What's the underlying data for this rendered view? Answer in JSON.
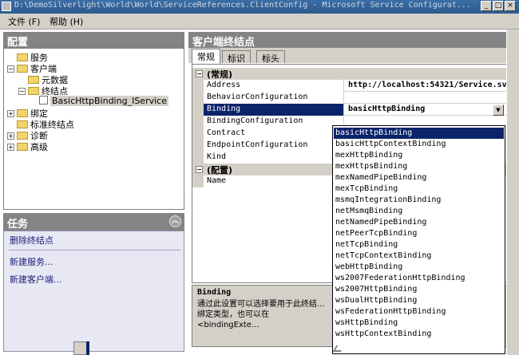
{
  "window": {
    "title": "D:\\DemoSilverlight\\World\\World\\ServiceReferences.ClientConfig - Microsoft Service Configurat..."
  },
  "menu": {
    "items": [
      "文件 (F)",
      "帮助 (H)"
    ]
  },
  "config_panel": {
    "title": "配置",
    "tree": [
      {
        "label": "服务",
        "toggle": "",
        "kind": "folder"
      },
      {
        "label": "客户端",
        "toggle": "−",
        "kind": "folder"
      },
      {
        "label": "元数据",
        "toggle": "",
        "kind": "folder"
      },
      {
        "label": "终结点",
        "toggle": "−",
        "kind": "folder"
      },
      {
        "label": "BasicHttpBinding_IService",
        "toggle": "",
        "kind": "doc"
      },
      {
        "label": "绑定",
        "toggle": "+",
        "kind": "folder"
      },
      {
        "label": "标准终结点",
        "toggle": "",
        "kind": "folder"
      },
      {
        "label": "诊断",
        "toggle": "+",
        "kind": "folder"
      },
      {
        "label": "高级",
        "toggle": "+",
        "kind": "folder"
      }
    ]
  },
  "tasks_panel": {
    "title": "任务",
    "links": [
      "删除终结点",
      "新建服务...",
      "新建客户端..."
    ]
  },
  "client_panel": {
    "title": "客户端终结点",
    "tabs": [
      "常规",
      "标识",
      "标头"
    ],
    "categories": [
      "(常规)",
      "(配置)"
    ],
    "properties": [
      {
        "name": "Address",
        "value": "http://localhost:54321/Service.sv"
      },
      {
        "name": "BehaviorConfiguration",
        "value": ""
      },
      {
        "name": "Binding",
        "value": "basicHttpBinding"
      },
      {
        "name": "BindingConfiguration",
        "value": ""
      },
      {
        "name": "Contract",
        "value": ""
      },
      {
        "name": "EndpointConfiguration",
        "value": ""
      },
      {
        "name": "Kind",
        "value": ""
      },
      {
        "name": "Name",
        "value": ""
      }
    ],
    "description": {
      "title": "Binding",
      "text": "通过此设置可以选择要用于此终结...\n绑定类型，也可以在 <bindingExte..."
    }
  },
  "binding_dropdown": {
    "selected": "basicHttpBinding",
    "options": [
      "basicHttpBinding",
      "basicHttpContextBinding",
      "mexHttpBinding",
      "mexHttpsBinding",
      "mexNamedPipeBinding",
      "mexTcpBinding",
      "msmqIntegrationBinding",
      "netMsmqBinding",
      "netNamedPipeBinding",
      "netPeerTcpBinding",
      "netTcpBinding",
      "netTcpContextBinding",
      "webHttpBinding",
      "ws2007FederationHttpBinding",
      "ws2007HttpBinding",
      "wsDualHttpBinding",
      "wsFederationHttpBinding",
      "wsHttpBinding",
      "wsHttpContextBinding"
    ]
  }
}
